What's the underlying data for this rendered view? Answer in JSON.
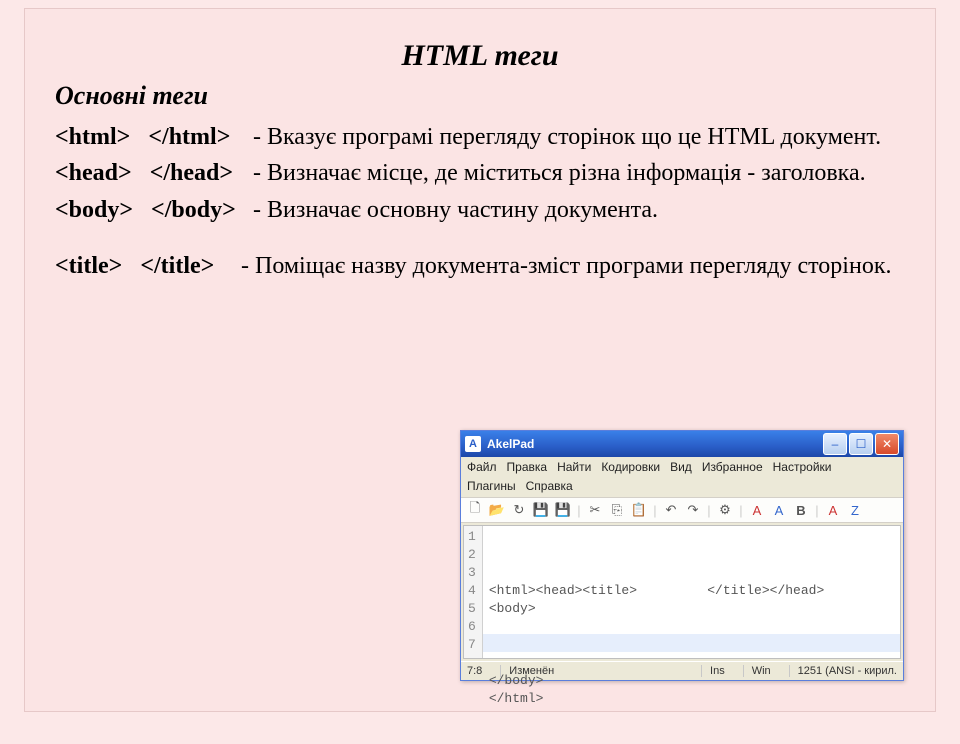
{
  "title": "HTML теги",
  "subhead": "Основні теги",
  "rows": [
    {
      "open": "<html>",
      "close": "</html>",
      "desc": "- Вказує програмі перегляду сторінок що це HTML документ."
    },
    {
      "open": "<head>",
      "close": "</head>",
      "desc": "- Визначає місце, де міститься різна інформація - заголовка."
    },
    {
      "open": "<body>",
      "close": "</body>",
      "desc": "- Визначає основну частину документа."
    },
    {
      "open": "<title>",
      "close": "</title>",
      "desc": "- Поміщає назву документа-зміст програми перегляду сторінок."
    }
  ],
  "editor": {
    "app": "AkelPad",
    "menus": [
      "Файл",
      "Правка",
      "Найти",
      "Кодировки",
      "Вид",
      "Избранное",
      "Настройки"
    ],
    "menus2": [
      "Плагины",
      "Справка"
    ],
    "lines": [
      "1",
      "2",
      "3",
      "4",
      "5",
      "6",
      "7"
    ],
    "code": "<html><head><title>         </title></head>\n<body>\n\n\n\n</body>\n</html>",
    "status": {
      "pos": "7:8",
      "mod": "Изменён",
      "ins": "Ins",
      "win": "Win",
      "enc": "1251 (ANSI - кирил."
    }
  }
}
